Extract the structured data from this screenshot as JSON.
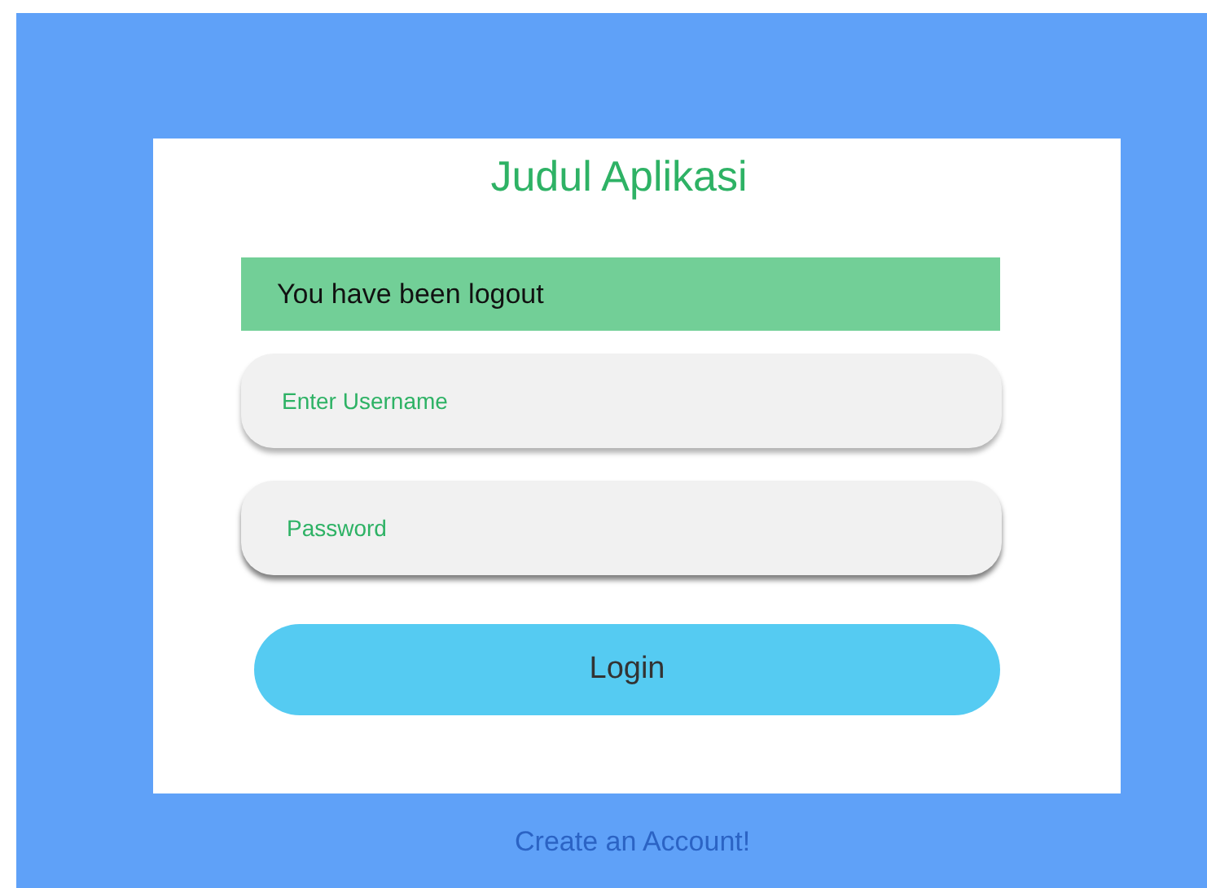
{
  "title": "Judul Aplikasi",
  "alert": "You have been logout",
  "fields": [
    {
      "placeholder": "Enter Username",
      "kind": "text"
    },
    {
      "placeholder": "Password",
      "kind": "password"
    }
  ],
  "login_button": "Login",
  "create_account_link": "Create an Account!"
}
